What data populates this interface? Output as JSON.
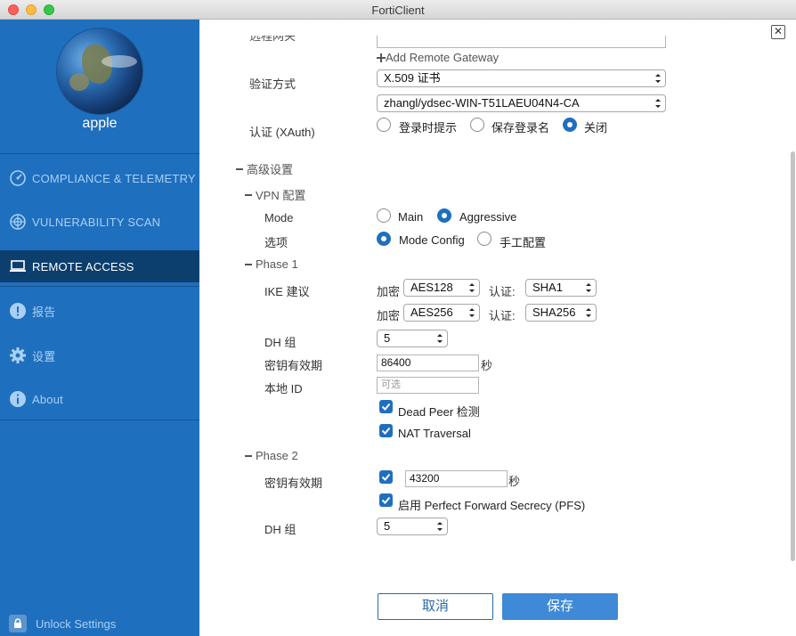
{
  "window": {
    "title": "FortiClient"
  },
  "sidebar": {
    "username": "apple",
    "items": [
      {
        "label": "COMPLIANCE & TELEMETRY",
        "icon": "gauge-icon"
      },
      {
        "label": "VULNERABILITY SCAN",
        "icon": "radar-icon"
      },
      {
        "label": "REMOTE ACCESS",
        "icon": "laptop-icon",
        "active": true
      },
      {
        "label": "报告",
        "icon": "alert-icon"
      },
      {
        "label": "设置",
        "icon": "gear-icon"
      },
      {
        "label": "About",
        "icon": "info-icon"
      }
    ],
    "unlock_label": "Unlock Settings"
  },
  "form": {
    "partial_label": "远程网关",
    "add_gateway": "Add Remote Gateway",
    "auth_method_label": "验证方式",
    "auth_method_value": "X.509 证书",
    "cert_value": "zhangl/ydsec-WIN-T51LAEU04N4-CA",
    "xauth_label": "认证 (XAuth)",
    "xauth_options": [
      "登录时提示",
      "保存登录名",
      "关闭"
    ],
    "advanced_label": "高级设置",
    "vpn_config_label": "VPN 配置",
    "mode_label": "Mode",
    "mode_options": [
      "Main",
      "Aggressive"
    ],
    "options_label": "选项",
    "options_options": [
      "Mode Config",
      "手工配置"
    ],
    "phase1_label": "Phase 1",
    "ike_label": "IKE 建议",
    "encrypt_label": "加密",
    "auth_label": "认证:",
    "ike_rows": [
      {
        "encrypt": "AES128",
        "auth": "SHA1"
      },
      {
        "encrypt": "AES256",
        "auth": "SHA256"
      }
    ],
    "dh_label": "DH 组",
    "dh1_value": "5",
    "key_life_label": "密钥有效期",
    "key_life1_value": "86400",
    "seconds": "秒",
    "local_id_label": "本地 ID",
    "local_id_placeholder": "可选",
    "dpd_label": "Dead Peer 检测",
    "nat_label": "NAT Traversal",
    "phase2_label": "Phase 2",
    "key_life2_value": "43200",
    "pfs_label": "启用 Perfect Forward Secrecy (PFS)",
    "dh2_value": "5"
  },
  "buttons": {
    "cancel": "取消",
    "save": "保存"
  },
  "colors": {
    "sidebar": "#1f6fbf",
    "active": "#0d3f6e",
    "accent": "#3f8ad6"
  }
}
